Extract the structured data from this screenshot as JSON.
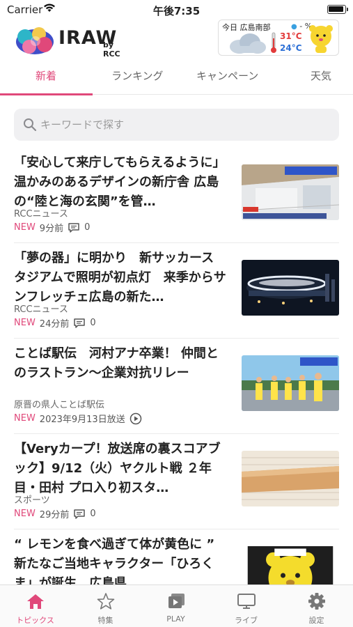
{
  "status_bar": {
    "carrier": "Carrier",
    "time": "午後7:35"
  },
  "header": {
    "logo_text": "IRAW",
    "logo_sub": "by RCC",
    "weather": {
      "title": "今日 広島南部",
      "rain_prob": "- %",
      "high": "31°C",
      "low": "24°C",
      "icon": "cloud-icon"
    }
  },
  "tabs": [
    {
      "label": "新着",
      "active": true
    },
    {
      "label": "ランキング"
    },
    {
      "label": "キャンペーン"
    },
    {
      "label": "天気"
    }
  ],
  "search": {
    "placeholder": "キーワードで探す"
  },
  "news": [
    {
      "title": "「安心して来庁してもらえるように」温かみのあるデザインの新庁舎 広島の“陸と海の玄関”を管…",
      "source": "RCCニュース",
      "badge": "NEW",
      "time": "9分前",
      "comments": "0"
    },
    {
      "title": "「夢の器」に明かり　新サッカースタジアムで照明が初点灯　来季からサンフレッチェ広島の新た…",
      "source": "RCCニュース",
      "badge": "NEW",
      "time": "24分前",
      "comments": "0"
    },
    {
      "title": "ことば駅伝　河村アナ卒業！ 仲間とのラストラン～企業対抗リレー",
      "source": "原晋の県人ことば駅伝",
      "badge": "NEW",
      "time": "2023年9月13日放送"
    },
    {
      "title": "【Veryカープ！放送席の裏スコアブック】9/12（火）ヤクルト戦 ２年目・田村 プロ入り初スタ…",
      "source": "スポーツ",
      "badge": "NEW",
      "time": "29分前",
      "comments": "0"
    },
    {
      "title": "“ レモンを食べ過ぎて体が黄色に ” 新たなご当地キャラクター「ひろくま」が誕生　広島県"
    }
  ],
  "bottom_nav": [
    {
      "label": "トピックス",
      "icon": "home-icon",
      "active": true
    },
    {
      "label": "特集",
      "icon": "star-icon"
    },
    {
      "label": "PLAY",
      "icon": "play-icon"
    },
    {
      "label": "ライブ",
      "icon": "tv-icon"
    },
    {
      "label": "設定",
      "icon": "gear-icon"
    }
  ],
  "colors": {
    "accent": "#e0487a",
    "high_temp": "#e23b3b",
    "low_temp": "#2b6fd6"
  }
}
